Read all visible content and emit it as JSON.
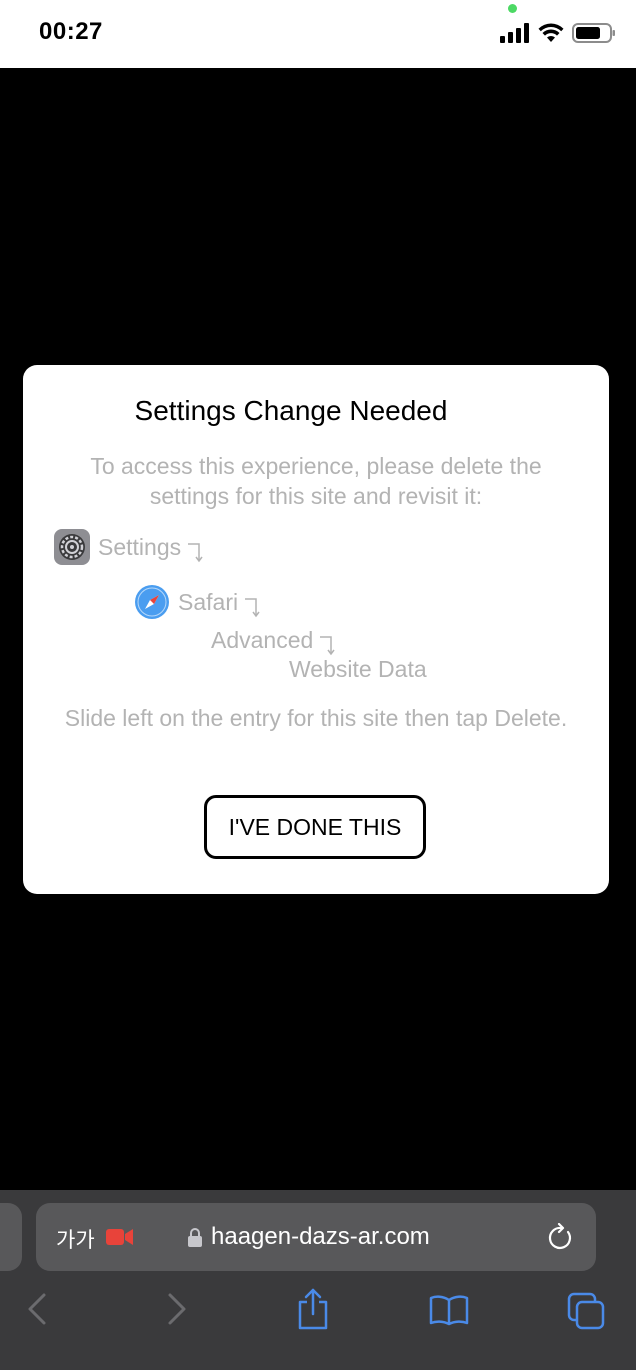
{
  "status_bar": {
    "time": "00:27"
  },
  "modal": {
    "title": "Settings Change Needed",
    "description": "To access this experience, please delete the settings for this site and revisit it:",
    "steps": {
      "settings": "Settings",
      "safari": "Safari",
      "advanced": "Advanced",
      "website_data": "Website Data"
    },
    "note": "Slide left on the entry for this site then tap Delete.",
    "button_label": "I'VE DONE THIS"
  },
  "browser": {
    "text_size_label": "가가",
    "url": "haagen-dazs-ar.com"
  },
  "colors": {
    "toolbar_bg": "#3a3a3c",
    "address_bg": "#58585a",
    "accent_blue": "#4a8ae8",
    "camera_red": "#e8433a",
    "muted_text": "#b3b3b3"
  }
}
